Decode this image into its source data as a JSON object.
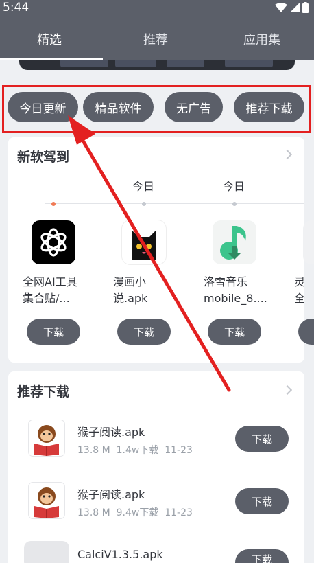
{
  "status_bar": {
    "time": "5:44"
  },
  "tabs": [
    {
      "label": "精选",
      "active": true
    },
    {
      "label": "推荐",
      "active": false
    },
    {
      "label": "应用集",
      "active": false
    }
  ],
  "chips": [
    {
      "label": "今日更新"
    },
    {
      "label": "精品软件"
    },
    {
      "label": "无广告"
    },
    {
      "label": "推荐下载"
    }
  ],
  "new_software": {
    "title": "新软驾到",
    "timeline": [
      {
        "label": ""
      },
      {
        "label": "今日"
      },
      {
        "label": "今日"
      }
    ],
    "apps": [
      {
        "name_line1": "全网AI工具",
        "name_line2": "集合贴/...",
        "icon": "openai-icon",
        "button": "下载"
      },
      {
        "name_line1": "漫画小",
        "name_line2": "说.apk",
        "icon": "black-cat-icon",
        "button": "下载"
      },
      {
        "name_line1": "洛雪音乐",
        "name_line2": "mobile_8....",
        "icon": "music-note-icon",
        "button": "下载"
      },
      {
        "name_line1": "灵",
        "name_line2": "全",
        "icon": "app-icon",
        "button": "下载"
      }
    ]
  },
  "recommended": {
    "title": "推荐下载",
    "items": [
      {
        "name": "猴子阅读.apk",
        "size": "13.8 M",
        "downloads": "1.4w下载",
        "date": "11-23",
        "icon": "monkey-reading-icon",
        "button": "下载"
      },
      {
        "name": "猴子阅读.apk",
        "size": "13.8 M",
        "downloads": "9.4w下载",
        "date": "11-23",
        "icon": "monkey-reading-icon",
        "button": "下载"
      },
      {
        "name": "CalciV1.3.5.apk",
        "size": "",
        "downloads": "",
        "date": "",
        "icon": "placeholder-icon",
        "button": "下载"
      }
    ]
  },
  "colors": {
    "header": "#5b5f69",
    "chip": "#5b5f69",
    "annotation_red": "#e32020",
    "active_dot": "#f07a55"
  }
}
